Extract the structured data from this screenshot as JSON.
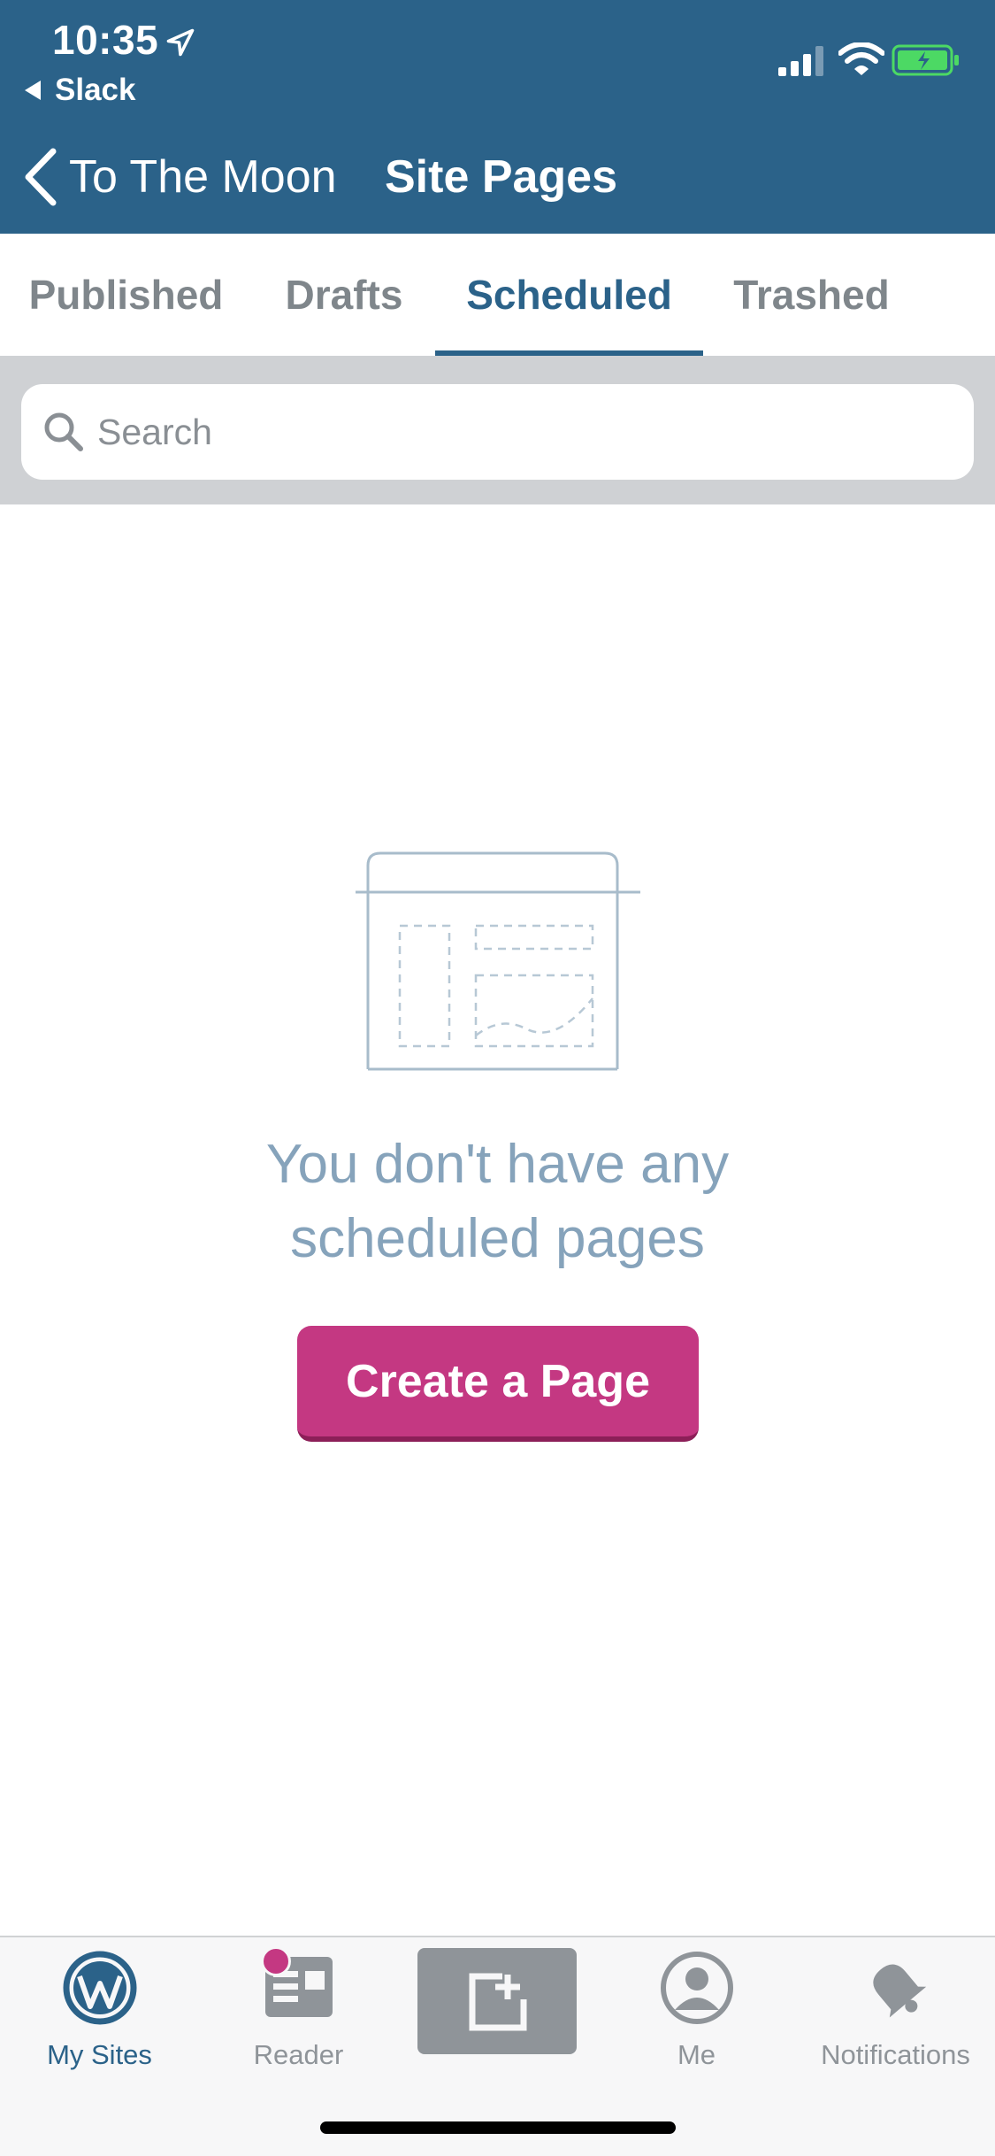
{
  "status_bar": {
    "time": "10:35",
    "back_app": "Slack"
  },
  "nav": {
    "site_name": "To The Moon",
    "title": "Site Pages"
  },
  "tabs": [
    {
      "label": "Published",
      "active": false
    },
    {
      "label": "Drafts",
      "active": false
    },
    {
      "label": "Scheduled",
      "active": true
    },
    {
      "label": "Trashed",
      "active": false
    }
  ],
  "search": {
    "placeholder": "Search",
    "value": ""
  },
  "empty_state": {
    "message_line1": "You don't have any",
    "message_line2": "scheduled pages",
    "button_label": "Create a Page"
  },
  "tab_bar": {
    "items": [
      {
        "label": "My Sites",
        "icon": "wordpress-icon",
        "active": true
      },
      {
        "label": "Reader",
        "icon": "reader-icon",
        "active": false,
        "badge": true
      },
      {
        "label": "",
        "icon": "new-post-icon",
        "active": false
      },
      {
        "label": "Me",
        "icon": "user-icon",
        "active": false
      },
      {
        "label": "Notifications",
        "icon": "bell-icon",
        "active": false
      }
    ]
  },
  "colors": {
    "header": "#2b6289",
    "accent": "#c43882",
    "active_tab": "#2b6289",
    "inactive": "#8f9499",
    "empty_text": "#86a3bb"
  }
}
